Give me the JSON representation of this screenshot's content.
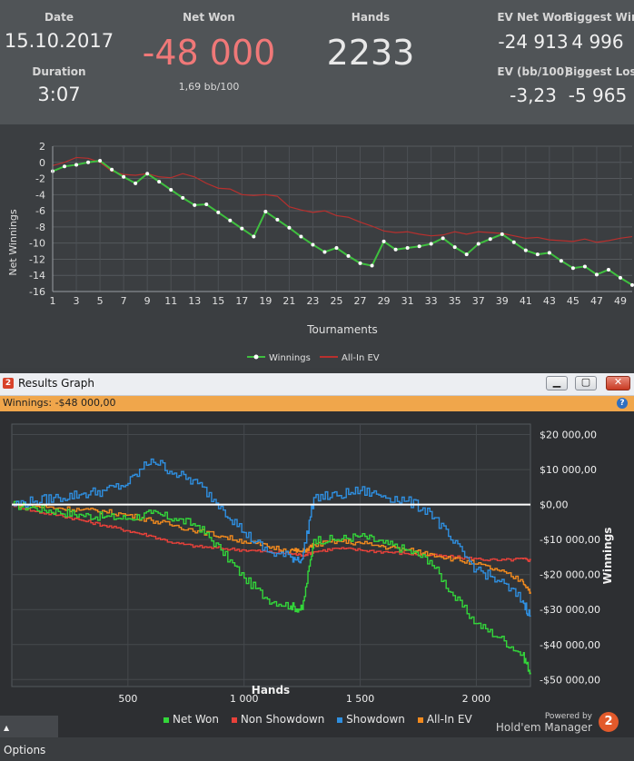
{
  "stats": {
    "date_label": "Date",
    "date_value": "15.10.2017",
    "duration_label": "Duration",
    "duration_value": "3:07",
    "net_won_label": "Net Won",
    "net_won_value": "-48 000",
    "net_won_sub": "1,69 bb/100",
    "hands_label": "Hands",
    "hands_value": "2233",
    "ev_net_won_label": "EV Net Won",
    "ev_net_won_value": "-24 913",
    "biggest_win_label": "Biggest Win",
    "biggest_win_value": "4 996",
    "ev_bb_label": "EV (bb/100)",
    "ev_bb_value": "-3,23",
    "biggest_loss_label": "Biggest Loss",
    "biggest_loss_value": "-5 965",
    "net_won_color": "#f07878"
  },
  "chart_data": [
    {
      "type": "line",
      "title": "",
      "xlabel": "Tournaments",
      "ylabel": "Net Winnings",
      "xlim": [
        1,
        50
      ],
      "ylim": [
        -16,
        2
      ],
      "x_ticks": [
        1,
        3,
        5,
        7,
        9,
        11,
        13,
        15,
        17,
        19,
        21,
        23,
        25,
        27,
        29,
        31,
        33,
        35,
        37,
        39,
        41,
        43,
        45,
        47,
        49
      ],
      "y_ticks": [
        2,
        0,
        -2,
        -4,
        -6,
        -8,
        -10,
        -12,
        -14,
        -16
      ],
      "grid": true,
      "legend": "bottom",
      "series": [
        {
          "name": "Winnings",
          "color": "#3fbf3f",
          "values": [
            -1.1,
            -0.5,
            -0.3,
            0.0,
            0.2,
            -0.9,
            -1.8,
            -2.6,
            -1.4,
            -2.4,
            -3.4,
            -4.4,
            -5.3,
            -5.2,
            -6.2,
            -7.2,
            -8.2,
            -9.2,
            -6.1,
            -7.1,
            -8.1,
            -9.2,
            -10.2,
            -11.1,
            -10.6,
            -11.6,
            -12.5,
            -12.8,
            -9.8,
            -10.8,
            -10.6,
            -10.4,
            -10.1,
            -9.4,
            -10.5,
            -11.4,
            -10.1,
            -9.5,
            -8.9,
            -9.9,
            -10.9,
            -11.4,
            -11.2,
            -12.2,
            -13.1,
            -12.9,
            -13.9,
            -13.3,
            -14.3,
            -15.2
          ]
        },
        {
          "name": "All-In EV",
          "color": "#b8302e",
          "values": [
            -0.4,
            0.0,
            0.6,
            0.5,
            0.0,
            -1.1,
            -1.5,
            -1.6,
            -1.4,
            -1.8,
            -1.9,
            -1.4,
            -1.8,
            -2.6,
            -3.2,
            -3.3,
            -4.0,
            -4.1,
            -4.0,
            -4.2,
            -5.5,
            -5.9,
            -6.2,
            -6.0,
            -6.6,
            -6.8,
            -7.4,
            -7.9,
            -8.5,
            -8.7,
            -8.6,
            -8.9,
            -9.1,
            -9.0,
            -8.6,
            -8.9,
            -8.6,
            -8.7,
            -8.8,
            -9.1,
            -9.4,
            -9.3,
            -9.6,
            -9.7,
            -9.8,
            -9.5,
            -9.9,
            -9.7,
            -9.4,
            -9.2
          ]
        }
      ]
    },
    {
      "type": "line",
      "title": "",
      "xlabel": "Hands",
      "ylabel": "Winnings",
      "xlim": [
        0,
        2233
      ],
      "ylim": [
        -52000,
        23000
      ],
      "x_ticks": [
        500,
        1000,
        1500,
        2000
      ],
      "x_tick_labels": [
        "500",
        "1 000",
        "1 500",
        "2 000"
      ],
      "y_ticks": [
        20000,
        10000,
        0,
        -10000,
        -20000,
        -30000,
        -40000,
        -50000
      ],
      "y_tick_labels": [
        "$20 000,00",
        "$10 000,00",
        "$0,00",
        "-$10 000,00",
        "-$20 000,00",
        "-$30 000,00",
        "-$40 000,00",
        "-$50 000,00"
      ],
      "grid": true,
      "legend": "bottom",
      "x": [
        0,
        100,
        200,
        300,
        400,
        500,
        600,
        700,
        800,
        900,
        1000,
        1100,
        1200,
        1250,
        1300,
        1400,
        1500,
        1600,
        1700,
        1800,
        1900,
        2000,
        2100,
        2200,
        2233
      ],
      "series": [
        {
          "name": "Net Won",
          "color": "#33d63a",
          "values": [
            0,
            -1000,
            -2000,
            -3000,
            -3500,
            -4000,
            -2500,
            -4000,
            -6000,
            -13000,
            -21000,
            -27000,
            -29000,
            -30000,
            -10000,
            -10000,
            -9000,
            -11000,
            -13000,
            -16000,
            -26000,
            -34000,
            -38000,
            -43000,
            -48000
          ]
        },
        {
          "name": "Non Showdown",
          "color": "#e8413a",
          "values": [
            0,
            -2000,
            -3000,
            -4500,
            -6000,
            -7500,
            -9000,
            -11000,
            -12000,
            -12500,
            -13000,
            -13500,
            -14000,
            -14500,
            -13500,
            -12500,
            -13000,
            -13500,
            -14000,
            -14500,
            -15000,
            -15500,
            -16000,
            -15500,
            -16000
          ]
        },
        {
          "name": "Showdown",
          "color": "#2f8fe0",
          "values": [
            0,
            1000,
            2000,
            3000,
            4000,
            6000,
            13000,
            9000,
            6000,
            -500,
            -8000,
            -13500,
            -15000,
            -15500,
            2000,
            2500,
            4000,
            2500,
            1000,
            -2000,
            -11000,
            -18500,
            -22000,
            -27500,
            -32000
          ]
        },
        {
          "name": "All-In EV",
          "color": "#f28a1e",
          "values": [
            0,
            -500,
            -1000,
            -1500,
            -2000,
            -3000,
            -4500,
            -6000,
            -7500,
            -9000,
            -10500,
            -12000,
            -13000,
            -13500,
            -11500,
            -10500,
            -11000,
            -12000,
            -13000,
            -14000,
            -15500,
            -17000,
            -19000,
            -22000,
            -24900
          ]
        }
      ]
    }
  ],
  "chart1_legend": {
    "winnings": "Winnings",
    "all_in_ev": "All-In EV"
  },
  "results_window": {
    "title": "Results Graph",
    "minimize_icon": "minimize-icon",
    "maximize_icon": "maximize-icon",
    "close_icon": "close-icon",
    "summary": "Winnings: -$48 000,00",
    "help_icon": "help-icon",
    "options_label": "Options",
    "powered_by": "Powered by",
    "brand": "Hold'em Manager",
    "brand_logo_text": "2"
  }
}
